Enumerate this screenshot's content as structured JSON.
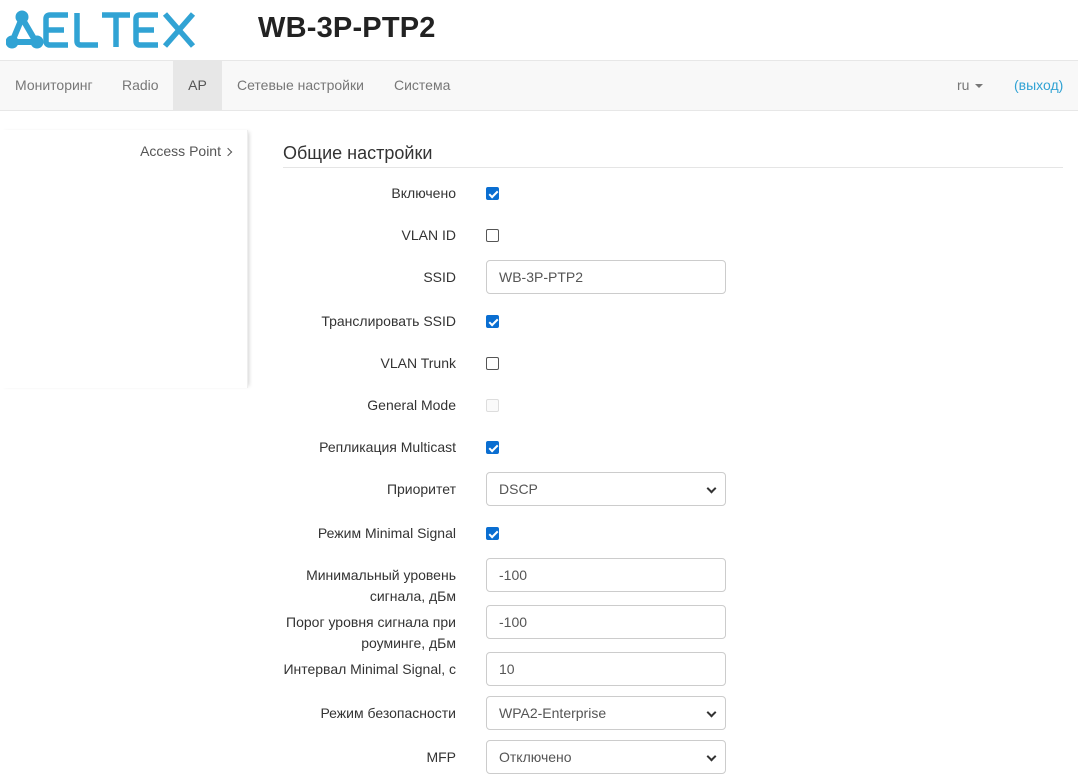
{
  "header": {
    "logo_text": "ELTEX",
    "device_name": "WB-3P-PTP2",
    "brand_color": "#31a3d4"
  },
  "nav": {
    "items": [
      {
        "label": "Мониторинг"
      },
      {
        "label": "Radio"
      },
      {
        "label": "AP",
        "active": true
      },
      {
        "label": "Сетевые настройки"
      },
      {
        "label": "Система"
      }
    ],
    "language": "ru",
    "logout": "(выход)"
  },
  "sidebar": {
    "items": [
      {
        "label": "Access Point"
      }
    ]
  },
  "section": {
    "title": "Общие настройки"
  },
  "form": {
    "enabled": {
      "label": "Включено",
      "checked": true
    },
    "vlan_id": {
      "label": "VLAN ID",
      "checked": false
    },
    "ssid": {
      "label": "SSID",
      "value": "WB-3P-PTP2"
    },
    "broadcast_ssid": {
      "label": "Транслировать SSID",
      "checked": true
    },
    "vlan_trunk": {
      "label": "VLAN Trunk",
      "checked": false
    },
    "general_mode": {
      "label": "General Mode",
      "checked": false,
      "disabled": true
    },
    "multicast_replication": {
      "label": "Репликация Multicast",
      "checked": true
    },
    "priority": {
      "label": "Приоритет",
      "value": "DSCP"
    },
    "minimal_signal_mode": {
      "label": "Режим Minimal Signal",
      "checked": true
    },
    "min_signal_level": {
      "label_line1": "Минимальный уровень",
      "label_line2": "сигнала, дБм",
      "value": "-100"
    },
    "roaming_threshold": {
      "label_line1": "Порог уровня сигнала при",
      "label_line2": "роуминге, дБм",
      "value": "-100"
    },
    "minimal_signal_interval": {
      "label": "Интервал Minimal Signal, с",
      "value": "10"
    },
    "security_mode": {
      "label": "Режим безопасности",
      "value": "WPA2-Enterprise"
    },
    "mfp": {
      "label": "MFP",
      "value": "Отключено"
    }
  }
}
